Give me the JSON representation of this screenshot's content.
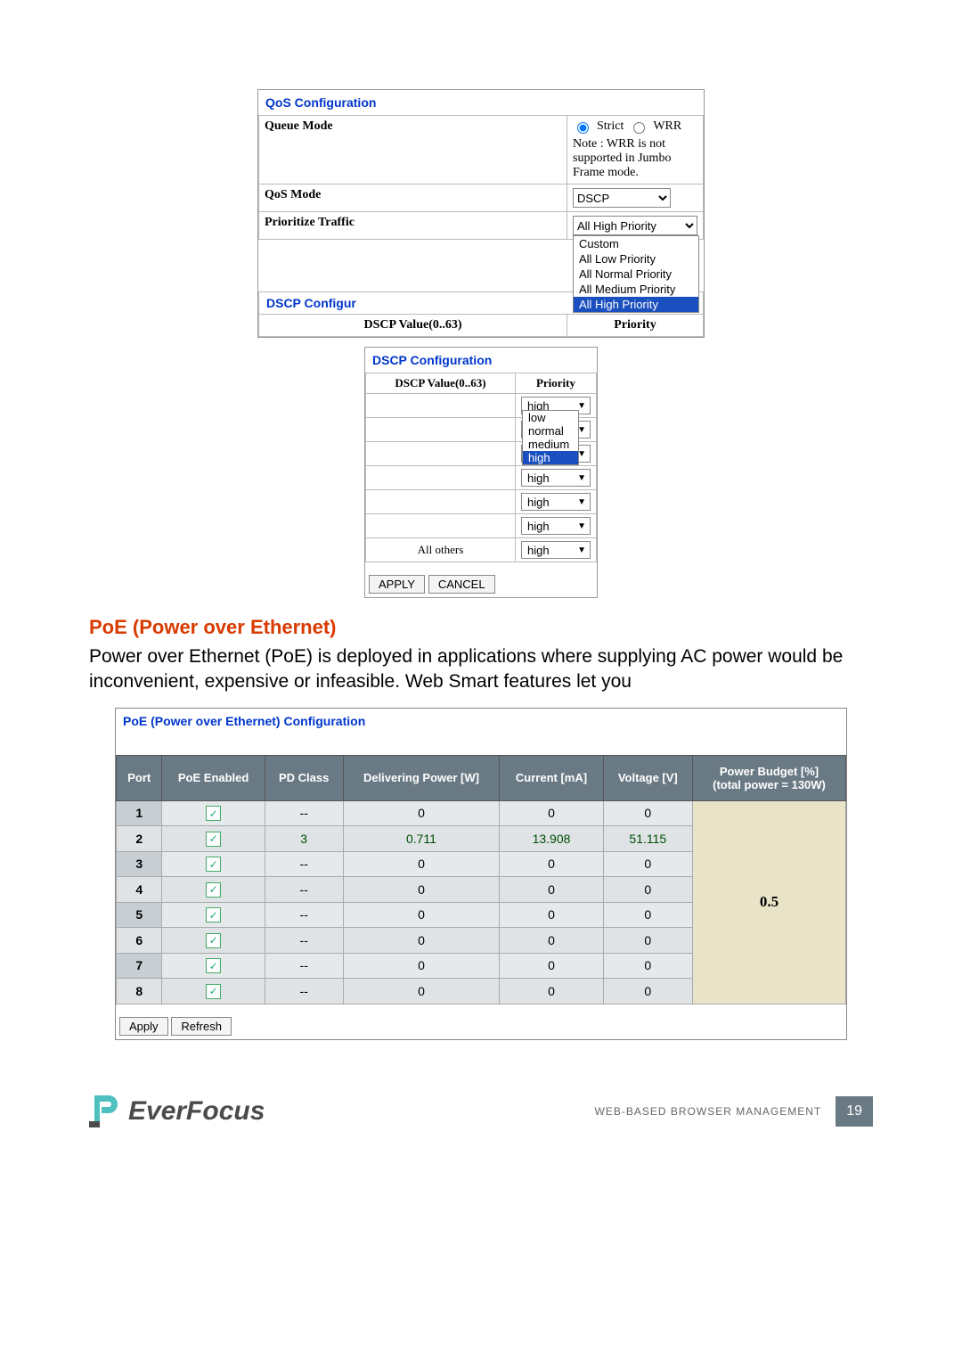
{
  "qos": {
    "title": "QoS Configuration",
    "queueModeLabel": "Queue Mode",
    "strict": "Strict",
    "wrr": "WRR",
    "note": "Note : WRR is not supported in Jumbo Frame mode.",
    "qosModeLabel": "QoS Mode",
    "qosModeValue": "DSCP",
    "prioritizeLabel": "Prioritize Traffic",
    "prioritizeValue": "All High Priority",
    "prioritizeOptions": [
      "Custom",
      "All Low Priority",
      "All Normal Priority",
      "All Medium Priority",
      "All High Priority"
    ],
    "dscpConfigurTrunc": "DSCP Configur",
    "dscpValueHeader": "DSCP Value(0..63)",
    "priorityHeader": "Priority"
  },
  "dscp": {
    "title": "DSCP Configuration",
    "valueHeader": "DSCP Value(0..63)",
    "priorityHeader": "Priority",
    "options": [
      "low",
      "normal",
      "medium",
      "high"
    ],
    "rows": [
      {
        "v": "",
        "p": "high"
      },
      {
        "v": "",
        "p": "high"
      },
      {
        "v": "",
        "p": "high"
      },
      {
        "v": "",
        "p": "high"
      },
      {
        "v": "",
        "p": "high"
      },
      {
        "v": "",
        "p": "high"
      },
      {
        "v": "All others",
        "p": "high"
      }
    ],
    "apply": "APPLY",
    "cancel": "CANCEL"
  },
  "poeHeading": "PoE (Power over Ethernet)",
  "poeBody": "Power over Ethernet (PoE) is deployed in applications where supplying AC power would be inconvenient, expensive or infeasible. Web Smart features let you",
  "poe": {
    "title": "PoE (Power over Ethernet) Configuration",
    "headers": {
      "port": "Port",
      "enabled": "PoE Enabled",
      "pdclass": "PD Class",
      "power": "Delivering Power [W]",
      "current": "Current [mA]",
      "voltage": "Voltage [V]",
      "budget": "Power Budget [%]\n(total power = 130W)"
    },
    "rows": [
      {
        "port": "1",
        "enabled": true,
        "pdclass": "--",
        "power": "0",
        "current": "0",
        "voltage": "0",
        "highlight": false
      },
      {
        "port": "2",
        "enabled": true,
        "pdclass": "3",
        "power": "0.711",
        "current": "13.908",
        "voltage": "51.115",
        "highlight": true
      },
      {
        "port": "3",
        "enabled": true,
        "pdclass": "--",
        "power": "0",
        "current": "0",
        "voltage": "0",
        "highlight": false
      },
      {
        "port": "4",
        "enabled": true,
        "pdclass": "--",
        "power": "0",
        "current": "0",
        "voltage": "0",
        "highlight": false
      },
      {
        "port": "5",
        "enabled": true,
        "pdclass": "--",
        "power": "0",
        "current": "0",
        "voltage": "0",
        "highlight": false
      },
      {
        "port": "6",
        "enabled": true,
        "pdclass": "--",
        "power": "0",
        "current": "0",
        "voltage": "0",
        "highlight": false
      },
      {
        "port": "7",
        "enabled": true,
        "pdclass": "--",
        "power": "0",
        "current": "0",
        "voltage": "0",
        "highlight": false
      },
      {
        "port": "8",
        "enabled": true,
        "pdclass": "--",
        "power": "0",
        "current": "0",
        "voltage": "0",
        "highlight": false
      }
    ],
    "budgetValue": "0.5",
    "apply": "Apply",
    "refresh": "Refresh"
  },
  "footer": {
    "brand": "EverFocus",
    "label": "WEB-BASED BROWSER MANAGEMENT",
    "page": "19"
  }
}
